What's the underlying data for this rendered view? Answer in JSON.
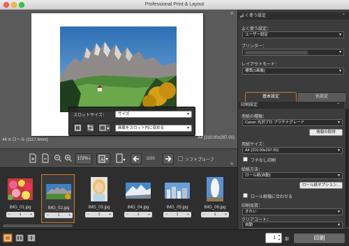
{
  "window": {
    "title": "Professional Print & Layout"
  },
  "preview": {
    "slot_label": "スロットサイズ：",
    "slot_value": "サイズ",
    "fit_value": "画像をスロット内に収める",
    "paper_left": "44 in ロール (1117.6mm)",
    "paper_right": "A4 (210.00x297.00)"
  },
  "toolbar": {
    "zoom": "172%",
    "page": "2/20",
    "softproof": "ソフトプルーフ"
  },
  "thumbnails": [
    {
      "name": "IMG_01.jpg",
      "count": "1"
    },
    {
      "name": "IMG_02.jpg",
      "count": "1"
    },
    {
      "name": "IMG_03.jpg",
      "count": "1"
    },
    {
      "name": "IMG_04.jpg",
      "count": "1"
    },
    {
      "name": "IMG_05.jpg",
      "count": "1"
    },
    {
      "name": "IMG_06.jpg",
      "count": "1"
    }
  ],
  "panel": {
    "favorites_header": "よく使う設定",
    "favorites_label": "よく使う設定：",
    "favorites_value": "ユーザー設定",
    "printer_label": "プリンター：",
    "layout_label": "レイアウトモード：",
    "layout_value": "標準(1画像)",
    "tab_basic": "基本設定",
    "tab_color": "色設定",
    "print_settings_header": "印刷設定",
    "media_label": "用紙の種類：",
    "media_value": "Canon 光沢プロ プラチナグレード",
    "info_button": "情報の取得",
    "paper_size_label": "用紙サイズ：",
    "paper_size_value": "A4 (210.00x297.00)",
    "borderless": "フチなし印刷",
    "source_label": "給紙方法：",
    "source_value": "ロール紙(自動)",
    "roll_options_button": "ロール紙オプション...",
    "fit_roll": "ロール紙幅に合わせる",
    "quality_label": "印刷品質：",
    "quality_value": "きれい",
    "clear_coat_label": "クリアコート：",
    "clear_coat_value": "自動"
  },
  "footer": {
    "copies": "1",
    "copies_unit": "部",
    "print_button": "印刷"
  }
}
